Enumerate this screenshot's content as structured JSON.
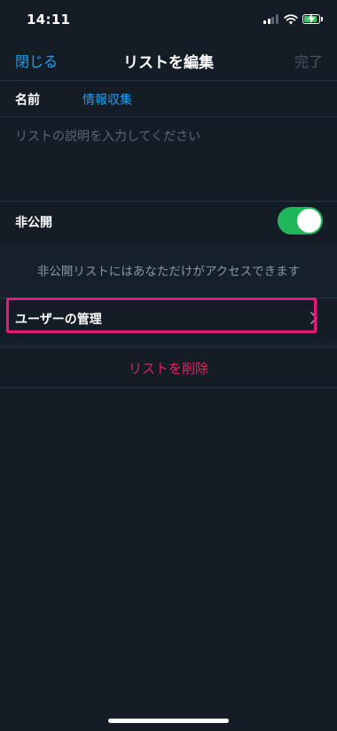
{
  "status_bar": {
    "time": "14:11",
    "battery_color": "#34c759",
    "signal_bars_active": 2,
    "signal_bars_total": 4,
    "battery_level": 0.75
  },
  "nav": {
    "close_label": "閉じる",
    "title": "リストを編集",
    "done_label": "完了"
  },
  "form": {
    "name_label": "名前",
    "name_value": "情報収集",
    "description_placeholder": "リストの説明を入力してください",
    "description_value": ""
  },
  "privacy": {
    "label": "非公開",
    "toggle_on": true,
    "info": "非公開リストにはあなただけがアクセスできます"
  },
  "manage_users": {
    "label": "ユーザーの管理",
    "highlight_color": "#e5197a"
  },
  "delete": {
    "label": "リストを削除",
    "color": "#e0245e"
  },
  "colors": {
    "accent": "#1da1f2",
    "background": "#141d26",
    "toggle_on": "#20b65a"
  }
}
